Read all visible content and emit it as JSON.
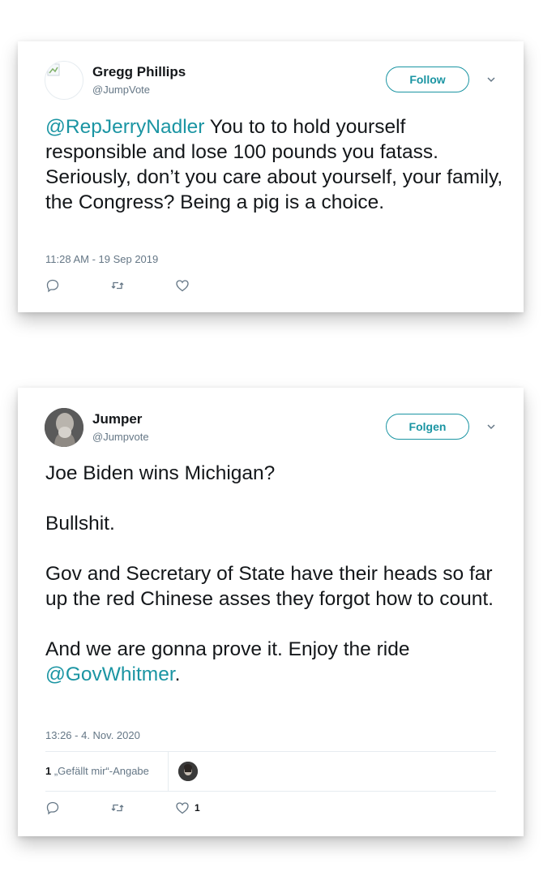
{
  "tweets": [
    {
      "name": "Gregg Phillips",
      "handle": "@JumpVote",
      "follow_label": "Follow",
      "text_mention": "@RepJerryNadler",
      "text_body": " You to to hold yourself responsible and lose 100 pounds you fatass. Seriously, don’t you care about yourself, your family, the Congress? Being a pig is a choice.",
      "timestamp": "11:28 AM - 19 Sep 2019"
    },
    {
      "name": "Jumper",
      "handle": "@Jumpvote",
      "follow_label": "Folgen",
      "paragraphs": [
        "Joe Biden wins Michigan?",
        "Bullshit.",
        "Gov and Secretary of State have their heads so far up the red Chinese asses they forgot how to count."
      ],
      "last_paragraph_text": "And we are gonna prove it. Enjoy the ride ",
      "last_paragraph_mention": "@GovWhitmer",
      "last_paragraph_end": ".",
      "timestamp": "13:26 - 4. Nov. 2020",
      "likes_count": "1",
      "likes_label": " „Gefällt mir“-Angabe",
      "like_action_count": "1"
    }
  ],
  "icons": {
    "reply": "reply-icon",
    "retweet": "retweet-icon",
    "like": "heart-icon",
    "caret": "chevron-down-icon"
  },
  "colors": {
    "accent": "#1b95a3",
    "text": "#14171a",
    "muted": "#657786"
  }
}
